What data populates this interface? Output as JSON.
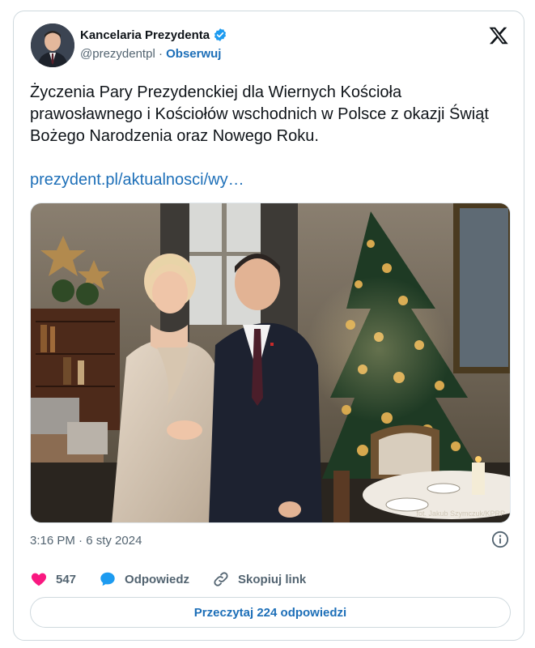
{
  "account": {
    "display_name": "Kancelaria Prezydenta",
    "handle": "@prezydentpl",
    "separator": " · ",
    "follow_label": "Obserwuj",
    "verified_color": "#1d9bf0"
  },
  "tweet": {
    "text": "Życzenia Pary Prezydenckiej dla Wiernych Kościoła prawosławnego i Kościołów wschodnich w Polsce z okazji Świąt Bożego Narodzenia oraz Nowego Roku.",
    "link": "prezydent.pl/aktualnosci/wy…",
    "timestamp": "3:16 PM · 6 sty 2024",
    "photo_credit": "fot. Jakub Szymczuk/KPRP"
  },
  "actions": {
    "likes": "547",
    "reply_label": "Odpowiedz",
    "copy_label": "Skopiuj link",
    "read_replies_label": "Przeczytaj 224 odpowiedzi"
  },
  "colors": {
    "link": "#1d6fb8",
    "like": "#f91880",
    "reply": "#1d9bf0",
    "muted": "#536471"
  },
  "icons": {
    "verified": "verified-badge-icon",
    "x_logo": "x-logo-icon",
    "info": "info-icon",
    "like": "heart-icon",
    "reply": "speech-bubble-icon",
    "copy": "link-icon"
  }
}
